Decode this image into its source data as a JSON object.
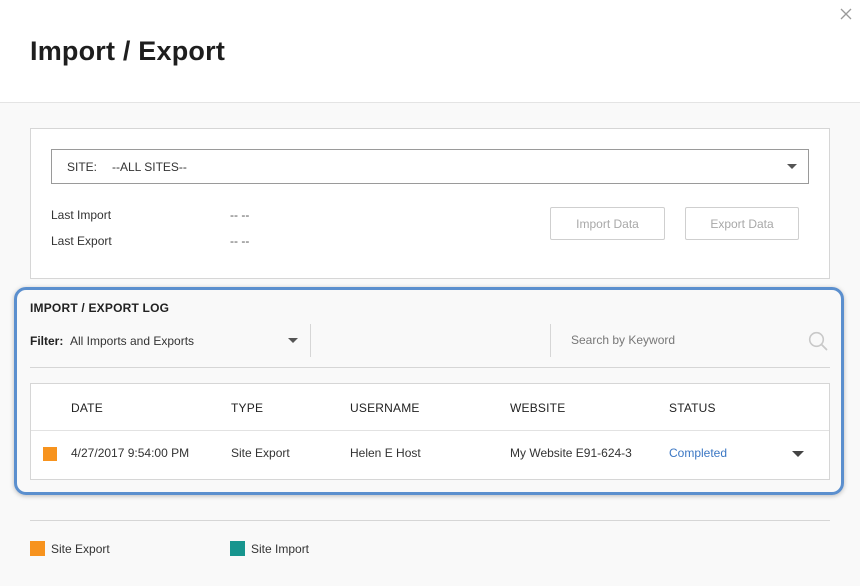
{
  "dialog": {
    "title": "Import / Export"
  },
  "site": {
    "label": "SITE:",
    "value": "--ALL SITES--",
    "last_import_label": "Last Import",
    "last_import_value": "-- --",
    "last_export_label": "Last Export",
    "last_export_value": "-- --",
    "import_button": "Import Data",
    "export_button": "Export Data"
  },
  "log": {
    "title": "IMPORT / EXPORT LOG",
    "filter_label": "Filter:",
    "filter_value": "All Imports and Exports",
    "search_placeholder": "Search by Keyword",
    "columns": [
      "DATE",
      "TYPE",
      "USERNAME",
      "WEBSITE",
      "STATUS"
    ],
    "rows": [
      {
        "date": "4/27/2017 9:54:00 PM",
        "type": "Site Export",
        "username": "Helen E Host",
        "website": "My Website E91-624-3",
        "status": "Completed",
        "type_color": "#f7931e"
      }
    ]
  },
  "legend": [
    {
      "label": "Site Export",
      "color": "#f7931e"
    },
    {
      "label": "Site Import",
      "color": "#17958e"
    }
  ],
  "icons": {
    "close": "close-icon",
    "site_dropdown": "chevron-down-icon",
    "filter_dropdown": "chevron-down-icon",
    "search": "search-icon",
    "row_expand": "chevron-down-icon"
  },
  "colors": {
    "highlight_border": "#5b8fce",
    "link": "#3b77c4",
    "export": "#f7931e",
    "import": "#17958e"
  }
}
